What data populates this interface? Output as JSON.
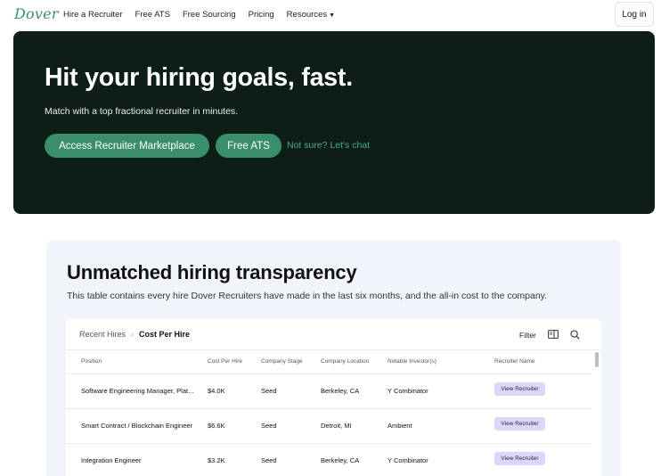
{
  "nav": {
    "logo": "Dover",
    "links": [
      "Hire a Recruiter",
      "Free ATS",
      "Free Sourcing",
      "Pricing",
      "Resources"
    ],
    "login": "Log in"
  },
  "hero": {
    "title": "Hit your hiring goals, fast.",
    "subtitle": "Match with a top fractional recruiter in minutes.",
    "primary_button": "Access Recruiter Marketplace",
    "secondary_button": "Free ATS",
    "link": "Not sure? Let's chat"
  },
  "transparency": {
    "title": "Unmatched hiring transparency",
    "subtitle": "This table contains every hire Dover Recruiters have made in the last six months, and the all-in cost to the company.",
    "breadcrumb": [
      "Recent Hires",
      "Cost Per Hire"
    ],
    "filter_label": "Filter",
    "columns": [
      "Position",
      "Cost Per Hire",
      "Company Stage",
      "Company Location",
      "Notable Investor(s)",
      "Recruiter Name"
    ],
    "rows": [
      {
        "position": "Software Engineering Manager, Plat...",
        "cost": "$4.0K",
        "stage": "Seed",
        "location": "Berkeley, CA",
        "investor": "Y Combinator",
        "action": "View Recruiter"
      },
      {
        "position": "Smart Contract / Blockchain Engineer",
        "cost": "$6.6K",
        "stage": "Seed",
        "location": "Detroit, MI",
        "investor": "Ambient",
        "action": "View Recruiter"
      },
      {
        "position": "Integration Engineer",
        "cost": "$3.2K",
        "stage": "Seed",
        "location": "Berkeley, CA",
        "investor": "Y Combinator",
        "action": "View Recruiter"
      }
    ]
  },
  "colors": {
    "hero_bg": "#0d1e17",
    "accent": "#3a8e6c",
    "section_bg": "#f1f4fb",
    "pill_bg": "#dcd6fa"
  }
}
